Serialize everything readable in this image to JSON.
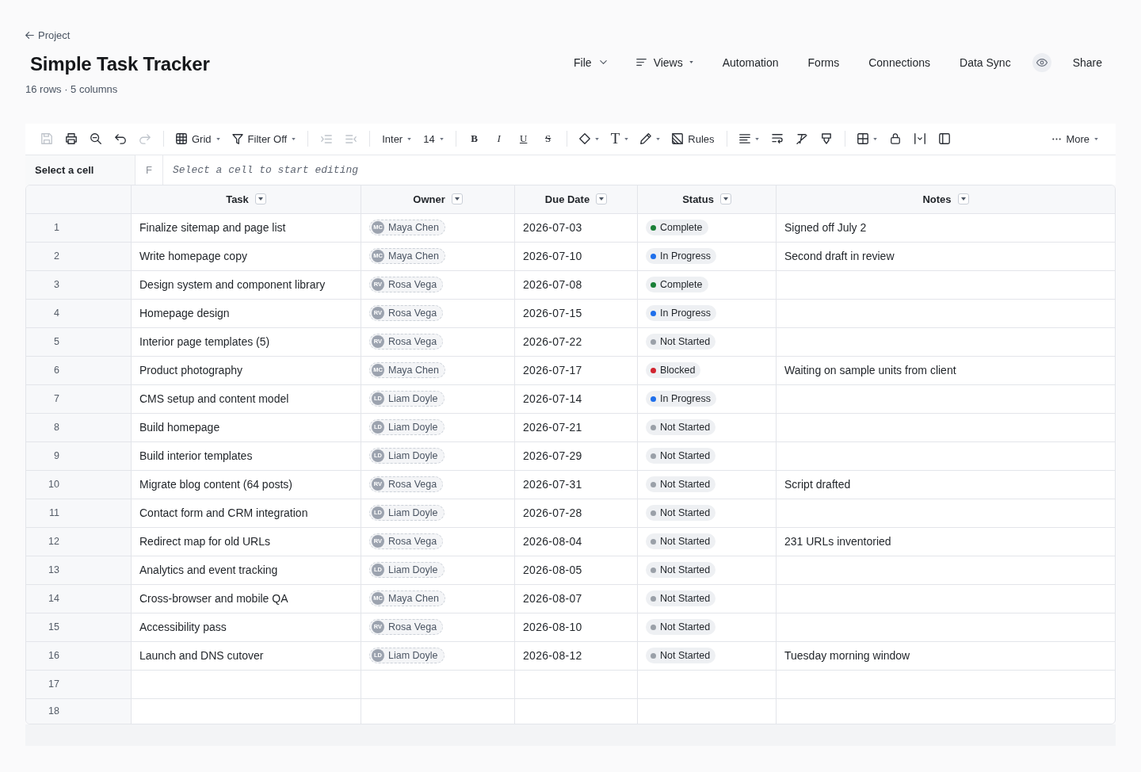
{
  "header": {
    "back_link": {
      "label": "Project"
    },
    "title": "Simple Task Tracker",
    "subtitle": "16 rows · 5 columns"
  },
  "nav": [
    {
      "kind": "menu",
      "label": "File"
    },
    {
      "kind": "iconmenu",
      "label": "Views"
    },
    {
      "kind": "link",
      "label": "Automation"
    },
    {
      "kind": "link",
      "label": "Forms"
    },
    {
      "kind": "link",
      "label": "Connections"
    },
    {
      "kind": "link",
      "label": "Data Sync"
    },
    {
      "kind": "icon"
    },
    {
      "kind": "link",
      "label": "Share"
    }
  ],
  "toolbar": {
    "groups": [
      [
        {
          "kind": "icon",
          "disabled": true
        },
        {
          "kind": "icon",
          "disabled": false
        },
        {
          "kind": "icon",
          "disabled": false
        },
        {
          "kind": "icon",
          "disabled": false
        },
        {
          "kind": "icon",
          "disabled": true
        }
      ],
      [
        {
          "kind": "menu",
          "label": "Grid",
          "disabled": false
        },
        {
          "kind": "menu",
          "label": "Filter Off",
          "disabled": false
        }
      ],
      [
        {
          "kind": "icon",
          "disabled": true
        },
        {
          "kind": "icon",
          "disabled": true
        }
      ],
      [
        {
          "kind": "menu",
          "label": "Inter",
          "disabled": false
        },
        {
          "kind": "menu",
          "label": "14",
          "disabled": false
        }
      ],
      [
        {
          "kind": "bold",
          "label": "B",
          "disabled": false
        },
        {
          "kind": "italic",
          "label": "I",
          "disabled": false
        },
        {
          "kind": "underline",
          "label": "U",
          "disabled": false
        },
        {
          "kind": "strike",
          "label": "S",
          "disabled": false
        }
      ],
      [
        {
          "kind": "menu",
          "disabled": false
        },
        {
          "kind": "glyphmenu",
          "label": "T",
          "disabled": false
        },
        {
          "kind": "menu",
          "disabled": false
        },
        {
          "kind": "button",
          "label": "Rules",
          "disabled": false
        }
      ],
      [
        {
          "kind": "menu",
          "disabled": false
        },
        {
          "kind": "icon",
          "disabled": false
        },
        {
          "kind": "icon",
          "disabled": false
        },
        {
          "kind": "icon",
          "disabled": false
        }
      ],
      [
        {
          "kind": "menu",
          "disabled": false
        },
        {
          "kind": "icon",
          "disabled": false
        },
        {
          "kind": "icon",
          "disabled": false
        },
        {
          "kind": "icon",
          "disabled": false
        }
      ]
    ],
    "more": {
      "label": "More"
    }
  },
  "formula_bar": {
    "cell_reference": "Select a cell",
    "function_glyph": "F",
    "placeholder": "Select a cell to start editing"
  },
  "table": {
    "columns": [
      {
        "label": "Task"
      },
      {
        "label": "Owner"
      },
      {
        "label": "Due Date"
      },
      {
        "label": "Status"
      },
      {
        "label": "Notes"
      }
    ],
    "rows": [
      {
        "number": "1",
        "task": "Finalize sitemap and page list",
        "owner": {
          "initials": "MC",
          "name": "Maya Chen"
        },
        "due_date": "2026-07-03",
        "status": {
          "label": "Complete",
          "color": "#1a7f37"
        },
        "notes": "Signed off July 2"
      },
      {
        "number": "2",
        "task": "Write homepage copy",
        "owner": {
          "initials": "MC",
          "name": "Maya Chen"
        },
        "due_date": "2026-07-10",
        "status": {
          "label": "In Progress",
          "color": "#1f6feb"
        },
        "notes": "Second draft in review"
      },
      {
        "number": "3",
        "task": "Design system and component library",
        "owner": {
          "initials": "RV",
          "name": "Rosa Vega"
        },
        "due_date": "2026-07-08",
        "status": {
          "label": "Complete",
          "color": "#1a7f37"
        }
      },
      {
        "number": "4",
        "task": "Homepage design",
        "owner": {
          "initials": "RV",
          "name": "Rosa Vega"
        },
        "due_date": "2026-07-15",
        "status": {
          "label": "In Progress",
          "color": "#1f6feb"
        }
      },
      {
        "number": "5",
        "task": "Interior page templates (5)",
        "owner": {
          "initials": "RV",
          "name": "Rosa Vega"
        },
        "due_date": "2026-07-22",
        "status": {
          "label": "Not Started",
          "color": "#9aa0a8"
        }
      },
      {
        "number": "6",
        "task": "Product photography",
        "owner": {
          "initials": "MC",
          "name": "Maya Chen"
        },
        "due_date": "2026-07-17",
        "status": {
          "label": "Blocked",
          "color": "#d1242f"
        },
        "notes": "Waiting on sample units from client"
      },
      {
        "number": "7",
        "task": "CMS setup and content model",
        "owner": {
          "initials": "LD",
          "name": "Liam Doyle"
        },
        "due_date": "2026-07-14",
        "status": {
          "label": "In Progress",
          "color": "#1f6feb"
        }
      },
      {
        "number": "8",
        "task": "Build homepage",
        "owner": {
          "initials": "LD",
          "name": "Liam Doyle"
        },
        "due_date": "2026-07-21",
        "status": {
          "label": "Not Started",
          "color": "#9aa0a8"
        }
      },
      {
        "number": "9",
        "task": "Build interior templates",
        "owner": {
          "initials": "LD",
          "name": "Liam Doyle"
        },
        "due_date": "2026-07-29",
        "status": {
          "label": "Not Started",
          "color": "#9aa0a8"
        }
      },
      {
        "number": "10",
        "task": "Migrate blog content (64 posts)",
        "owner": {
          "initials": "RV",
          "name": "Rosa Vega"
        },
        "due_date": "2026-07-31",
        "status": {
          "label": "Not Started",
          "color": "#9aa0a8"
        },
        "notes": "Script drafted"
      },
      {
        "number": "11",
        "task": "Contact form and CRM integration",
        "owner": {
          "initials": "LD",
          "name": "Liam Doyle"
        },
        "due_date": "2026-07-28",
        "status": {
          "label": "Not Started",
          "color": "#9aa0a8"
        }
      },
      {
        "number": "12",
        "task": "Redirect map for old URLs",
        "owner": {
          "initials": "RV",
          "name": "Rosa Vega"
        },
        "due_date": "2026-08-04",
        "status": {
          "label": "Not Started",
          "color": "#9aa0a8"
        },
        "notes": "231 URLs inventoried"
      },
      {
        "number": "13",
        "task": "Analytics and event tracking",
        "owner": {
          "initials": "LD",
          "name": "Liam Doyle"
        },
        "due_date": "2026-08-05",
        "status": {
          "label": "Not Started",
          "color": "#9aa0a8"
        }
      },
      {
        "number": "14",
        "task": "Cross-browser and mobile QA",
        "owner": {
          "initials": "MC",
          "name": "Maya Chen"
        },
        "due_date": "2026-08-07",
        "status": {
          "label": "Not Started",
          "color": "#9aa0a8"
        }
      },
      {
        "number": "15",
        "task": "Accessibility pass",
        "owner": {
          "initials": "RV",
          "name": "Rosa Vega"
        },
        "due_date": "2026-08-10",
        "status": {
          "label": "Not Started",
          "color": "#9aa0a8"
        }
      },
      {
        "number": "16",
        "task": "Launch and DNS cutover",
        "owner": {
          "initials": "LD",
          "name": "Liam Doyle"
        },
        "due_date": "2026-08-12",
        "status": {
          "label": "Not Started",
          "color": "#9aa0a8"
        },
        "notes": "Tuesday morning window"
      },
      {
        "number": "17"
      },
      {
        "number": "18"
      }
    ]
  }
}
